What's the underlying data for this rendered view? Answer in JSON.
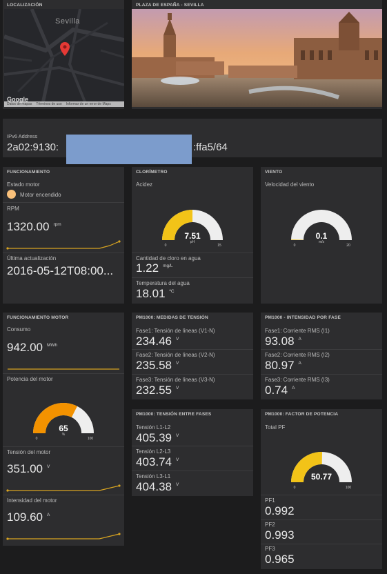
{
  "map": {
    "title": "LOCALIZACIÓN",
    "city": "Sevilla",
    "logo": "Google",
    "footer_links": [
      "Datos de mapas",
      "Términos de uso",
      "Informar de un error de Maps"
    ]
  },
  "photo": {
    "title": "PLAZA DE ESPAÑA - SEVILLA"
  },
  "ipv6": {
    "label": "IPv6 Address",
    "prefix": "2a02:9130:",
    "suffix": ":ffa5/64"
  },
  "funcionamiento": {
    "title": "FUNCIONAMIENTO",
    "estado_label": "Estado motor",
    "estado_value": "Motor encendido",
    "rpm_label": "RPM",
    "rpm_value": "1320.00",
    "rpm_unit": "rpm",
    "update_label": "Última actualización",
    "update_value": "2016-05-12T08:00..."
  },
  "clorimetro": {
    "title": "CLORÍMETRO",
    "acidez_label": "Acidez",
    "acidez_value": "7.51",
    "acidez_unit": "pH",
    "acidez_min": "0",
    "acidez_max": "15",
    "acidez_fraction": 0.5,
    "cloro_label": "Cantidad de cloro en agua",
    "cloro_value": "1.22",
    "cloro_unit": "mg/L",
    "temp_label": "Temperatura del agua",
    "temp_value": "18.01",
    "temp_unit": "ºC"
  },
  "viento": {
    "title": "VIENTO",
    "vel_label": "Velocidad del viento",
    "vel_value": "0.1",
    "vel_unit": "m/s",
    "vel_min": "0",
    "vel_max": "20",
    "vel_fraction": 0.005
  },
  "motor": {
    "title": "FUNCIONAMIENTO MOTOR",
    "consumo_label": "Consumo",
    "consumo_value": "942.00",
    "consumo_unit": "MWh",
    "potencia_label": "Potencia del motor",
    "potencia_value": "65",
    "potencia_unit": "%",
    "potencia_min": "0",
    "potencia_max": "100",
    "potencia_fraction": 0.65,
    "tension_label": "Tensión del motor",
    "tension_value": "351.00",
    "tension_unit": "V",
    "intensidad_label": "Intensidad del motor",
    "intensidad_value": "109.60",
    "intensidad_unit": "A"
  },
  "pm_tension": {
    "title": "PM1000: MEDIDAS DE TENSIÓN",
    "items": [
      {
        "label": "Fase1: Tensión de líneas (V1-N)",
        "value": "234.46",
        "unit": "V"
      },
      {
        "label": "Fase2: Tensión de líneas (V2-N)",
        "value": "235.58",
        "unit": "V"
      },
      {
        "label": "Fase3: Tensión de líneas (V3-N)",
        "value": "232.55",
        "unit": "V"
      }
    ]
  },
  "pm_intensidad": {
    "title": "PM1000 - INTENSIDAD POR FASE",
    "items": [
      {
        "label": "Fase1: Corriente RMS (I1)",
        "value": "93.08",
        "unit": "A"
      },
      {
        "label": "Fase2: Corriente RMS (I2)",
        "value": "80.97",
        "unit": "A"
      },
      {
        "label": "Fase3: Corriente RMS (I3)",
        "value": "0.74",
        "unit": "A"
      }
    ]
  },
  "pm_fases": {
    "title": "PM1000: TENSIÓN ENTRE FASES",
    "items": [
      {
        "label": "Tensión L1-L2",
        "value": "405.39",
        "unit": "V"
      },
      {
        "label": "Tensión L2-L3",
        "value": "403.74",
        "unit": "V"
      },
      {
        "label": "Tensión L3-L1",
        "value": "404.38",
        "unit": "V"
      }
    ]
  },
  "pm_factor": {
    "title": "PM1000: FACTOR DE POTENCIA",
    "total_label": "Total PF",
    "total_value": "50.77",
    "total_min": "0",
    "total_max": "100",
    "total_fraction": 0.5077,
    "items": [
      {
        "label": "PF1",
        "value": "0.992"
      },
      {
        "label": "PF2",
        "value": "0.993"
      },
      {
        "label": "PF3",
        "value": "0.965"
      }
    ]
  },
  "colors": {
    "gauge_yellow": "#f2c318",
    "gauge_orange": "#f39200",
    "gauge_track": "#eeeeee",
    "sparkline": "#d8a421",
    "redaction": "#7c9ccc"
  }
}
